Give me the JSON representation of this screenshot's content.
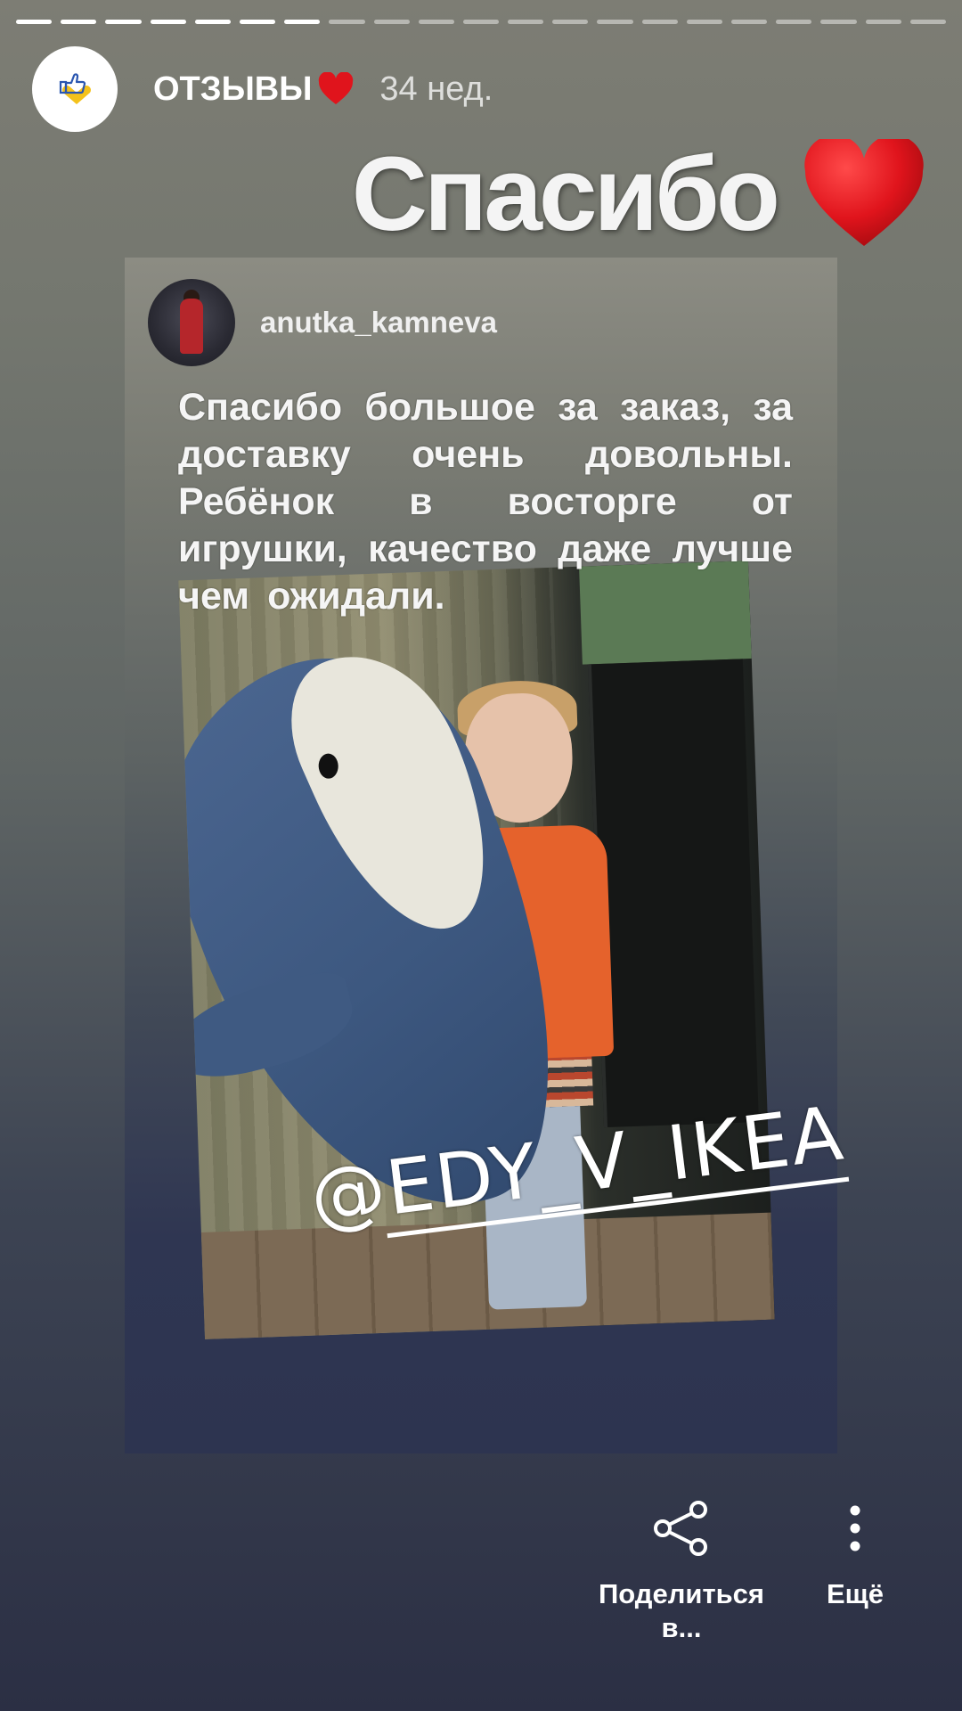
{
  "story": {
    "progress": {
      "total_segments": 21,
      "seen_segments": 7
    },
    "author": "ОТЗЫВЫ",
    "time_ago": "34 нед.",
    "headline": "Спасибо",
    "accent_heart_color": "#e0141c"
  },
  "repost": {
    "username": "anutka_kamneva",
    "text": "Спасибо большое за заказ, за доставку очень довольны. Ребёнок в восторге от игрушки, качество даже лучше чем ожидали.",
    "photo_tag": "@EDY_V_IKEA"
  },
  "actions": {
    "share_label": "Поделиться в...",
    "more_label": "Ещё"
  },
  "icons": {
    "story_avatar": "thumbs-up-heart-logo-icon",
    "share": "share-icon",
    "more": "more-vertical-icon"
  }
}
